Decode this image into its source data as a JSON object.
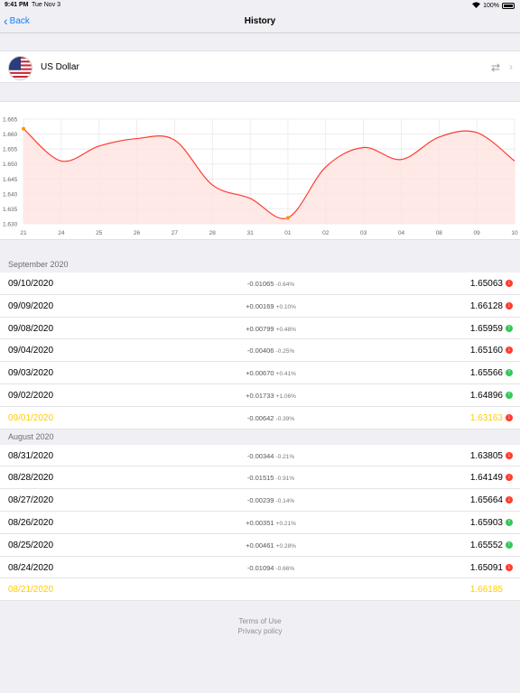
{
  "status_bar": {
    "time": "9:41 PM",
    "date": "Tue Nov 3",
    "battery": "100%"
  },
  "nav": {
    "back_label": "Back",
    "title": "History"
  },
  "currency": {
    "name": "US Dollar"
  },
  "chart_data": {
    "type": "area",
    "y_ticks": [
      "1.665",
      "1.660",
      "1.655",
      "1.650",
      "1.645",
      "1.640",
      "1.635",
      "1.630"
    ],
    "ylim": [
      1.63,
      1.665
    ],
    "x_ticks": [
      "21",
      "24",
      "25",
      "26",
      "27",
      "28",
      "31",
      "01",
      "02",
      "03",
      "04",
      "08",
      "09",
      "10"
    ],
    "values": [
      1.6618,
      1.651,
      1.656,
      1.6585,
      1.658,
      1.643,
      1.6385,
      1.632,
      1.649,
      1.6555,
      1.6515,
      1.659,
      1.6605,
      1.651
    ],
    "colors": {
      "line": "#ff3b30",
      "fill": "#ffe3e1",
      "marker": "#ff9500"
    },
    "grid": true
  },
  "sections": [
    {
      "title": "September 2020",
      "rows": [
        {
          "date": "09/10/2020",
          "change": "-0.01065",
          "pct": "-0.64%",
          "value": "1.65063",
          "dir": "down",
          "hl": false
        },
        {
          "date": "09/09/2020",
          "change": "+0.00169",
          "pct": "+0.10%",
          "value": "1.66128",
          "dir": "down",
          "hl": false
        },
        {
          "date": "09/08/2020",
          "change": "+0.00799",
          "pct": "+0.48%",
          "value": "1.65959",
          "dir": "up",
          "hl": false
        },
        {
          "date": "09/04/2020",
          "change": "-0.00406",
          "pct": "-0.25%",
          "value": "1.65160",
          "dir": "down",
          "hl": false
        },
        {
          "date": "09/03/2020",
          "change": "+0.00670",
          "pct": "+0.41%",
          "value": "1.65566",
          "dir": "up",
          "hl": false
        },
        {
          "date": "09/02/2020",
          "change": "+0.01733",
          "pct": "+1.06%",
          "value": "1.64896",
          "dir": "up",
          "hl": false
        },
        {
          "date": "09/01/2020",
          "change": "-0.00642",
          "pct": "-0.39%",
          "value": "1.63163",
          "dir": "down",
          "hl": true
        }
      ]
    },
    {
      "title": "August 2020",
      "rows": [
        {
          "date": "08/31/2020",
          "change": "-0.00344",
          "pct": "-0.21%",
          "value": "1.63805",
          "dir": "down",
          "hl": false
        },
        {
          "date": "08/28/2020",
          "change": "-0.01515",
          "pct": "-0.91%",
          "value": "1.64149",
          "dir": "down",
          "hl": false
        },
        {
          "date": "08/27/2020",
          "change": "-0.00239",
          "pct": "-0.14%",
          "value": "1.65664",
          "dir": "down",
          "hl": false
        },
        {
          "date": "08/26/2020",
          "change": "+0.00351",
          "pct": "+0.21%",
          "value": "1.65903",
          "dir": "up",
          "hl": false
        },
        {
          "date": "08/25/2020",
          "change": "+0.00461",
          "pct": "+0.28%",
          "value": "1.65552",
          "dir": "up",
          "hl": false
        },
        {
          "date": "08/24/2020",
          "change": "-0.01094",
          "pct": "-0.66%",
          "value": "1.65091",
          "dir": "down",
          "hl": false
        },
        {
          "date": "08/21/2020",
          "change": "",
          "pct": "",
          "value": "1.66185",
          "dir": "",
          "hl": true
        }
      ]
    }
  ],
  "footer": {
    "terms": "Terms of Use",
    "privacy": "Privacy policy"
  }
}
